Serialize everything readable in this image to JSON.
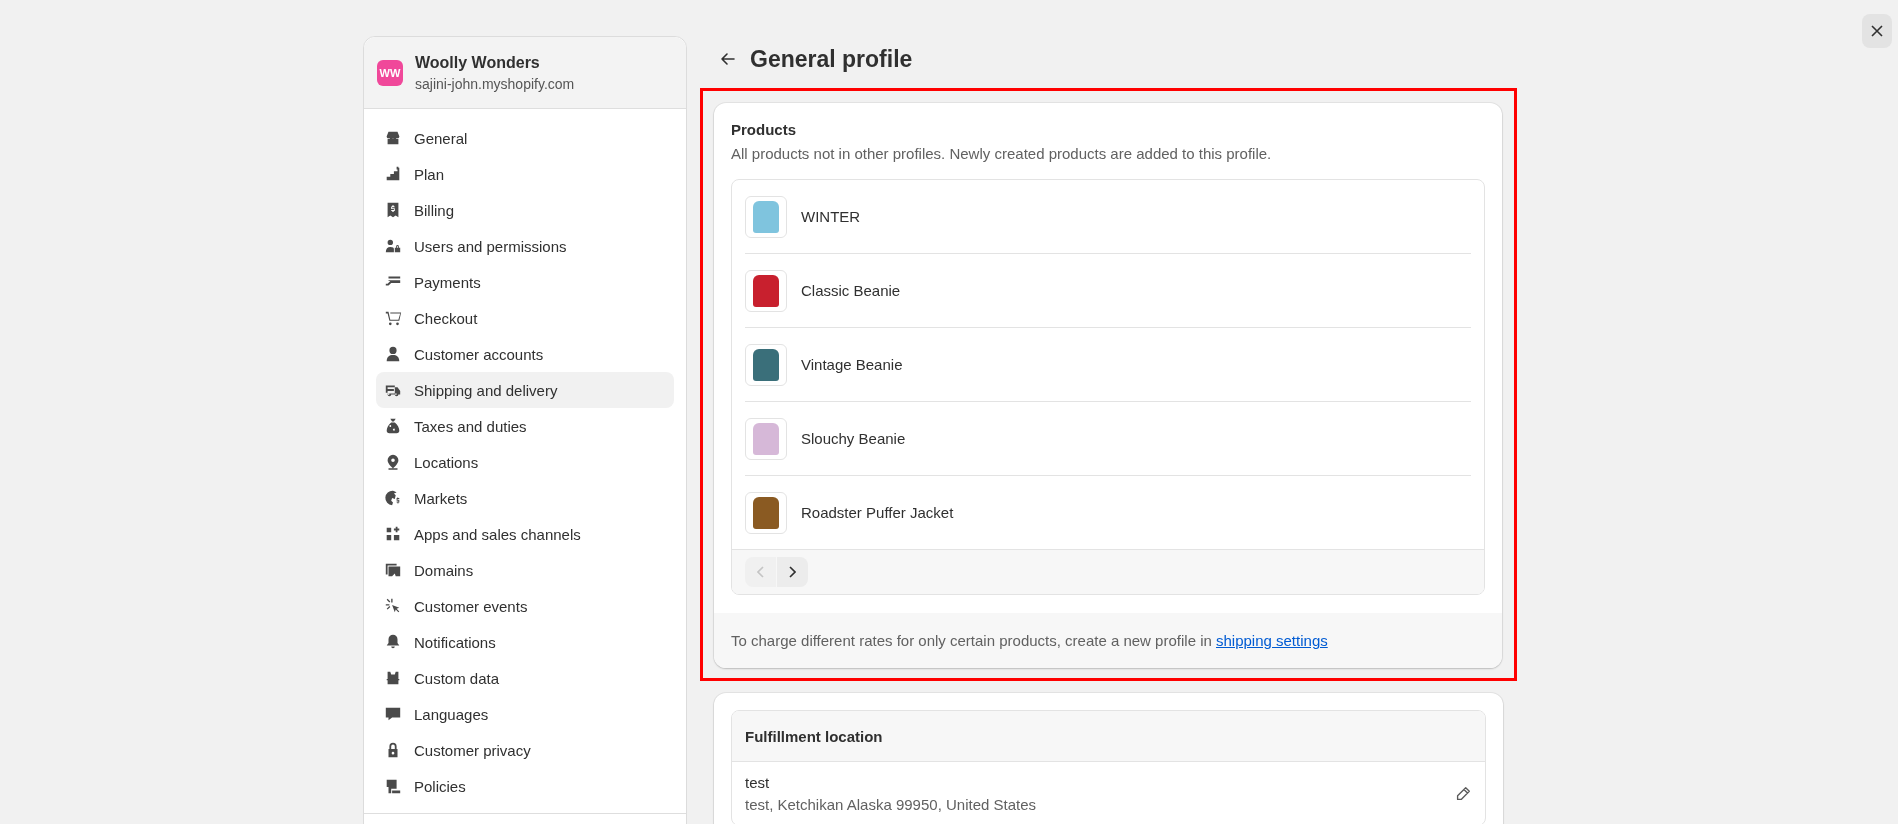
{
  "store": {
    "logo": "WW",
    "name": "Woolly Wonders",
    "domain": "sajini-john.myshopify.com"
  },
  "nav": [
    {
      "label": "General",
      "selected": false
    },
    {
      "label": "Plan",
      "selected": false
    },
    {
      "label": "Billing",
      "selected": false
    },
    {
      "label": "Users and permissions",
      "selected": false
    },
    {
      "label": "Payments",
      "selected": false
    },
    {
      "label": "Checkout",
      "selected": false
    },
    {
      "label": "Customer accounts",
      "selected": false
    },
    {
      "label": "Shipping and delivery",
      "selected": true
    },
    {
      "label": "Taxes and duties",
      "selected": false
    },
    {
      "label": "Locations",
      "selected": false
    },
    {
      "label": "Markets",
      "selected": false
    },
    {
      "label": "Apps and sales channels",
      "selected": false
    },
    {
      "label": "Domains",
      "selected": false
    },
    {
      "label": "Customer events",
      "selected": false
    },
    {
      "label": "Notifications",
      "selected": false
    },
    {
      "label": "Custom data",
      "selected": false
    },
    {
      "label": "Languages",
      "selected": false
    },
    {
      "label": "Customer privacy",
      "selected": false
    },
    {
      "label": "Policies",
      "selected": false
    }
  ],
  "page": {
    "title": "General profile"
  },
  "products_card": {
    "highlighted": true,
    "title": "Products",
    "description": "All products not in other profiles. Newly created products are added to this profile.",
    "products": [
      {
        "name": "WINTER",
        "color": "#7fc4de"
      },
      {
        "name": "Classic Beanie",
        "color": "#c8202e"
      },
      {
        "name": "Vintage Beanie",
        "color": "#3a6f7a"
      },
      {
        "name": "Slouchy Beanie",
        "color": "#d6b8d8"
      },
      {
        "name": "Roadster Puffer Jacket",
        "color": "#8a5a22"
      }
    ],
    "pagination": {
      "previous_disabled": true,
      "next_disabled": false
    },
    "footer_text": "To charge different rates for only certain products, create a new profile in ",
    "footer_link": "shipping settings"
  },
  "fulfillment_card": {
    "title": "Fulfillment location",
    "locations": [
      {
        "name": "test",
        "address": "test, Ketchikan Alaska 99950, United States"
      }
    ]
  }
}
